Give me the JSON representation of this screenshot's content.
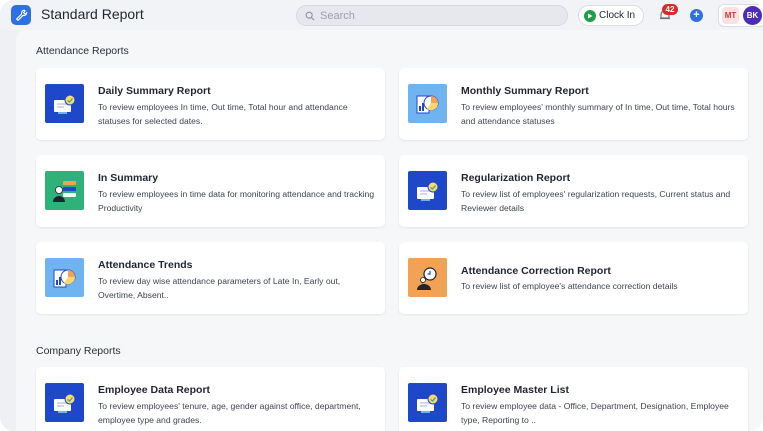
{
  "header": {
    "app_icon": "wrench-icon",
    "title": "Standard Report",
    "search_placeholder": "Search",
    "clock_in_label": "Clock In",
    "notification_count": "42",
    "user_initials": "MT",
    "avatar_initials": "BK"
  },
  "sections": [
    {
      "title": "Attendance Reports",
      "cards": [
        {
          "title": "Daily Summary Report",
          "desc": "To review employees In time, Out time, Total hour and attendance statuses for selected dates.",
          "icon": "report-chart-icon"
        },
        {
          "title": "Monthly Summary Report",
          "desc": "To review employees' monthly summary of In time, Out time, Total hours and attendance statuses",
          "icon": "pie-chart-icon"
        },
        {
          "title": "In Summary",
          "desc": "To review employees in time data for monitoring attendance and tracking Productivity",
          "icon": "person-list-icon"
        },
        {
          "title": "Regularization Report",
          "desc": "To review list of employees' regularization requests, Current status and Reviewer details",
          "icon": "report-chart-icon"
        },
        {
          "title": "Attendance Trends",
          "desc": "To review day wise attendance parameters of Late In, Early out, Overtime, Absent..",
          "icon": "pie-chart-icon"
        },
        {
          "title": "Attendance Correction Report",
          "desc": "To review list of employee's attendance correction details",
          "icon": "person-search-icon"
        }
      ]
    },
    {
      "title": "Company Reports",
      "cards": [
        {
          "title": "Employee Data Report",
          "desc": "To review employees' tenure, age, gender against office, department, employee type and grades.",
          "icon": "report-chart-icon"
        },
        {
          "title": "Employee Master List",
          "desc": "To review employee data - Office, Department, Designation, Employee type, Reporting to ..",
          "icon": "report-chart-icon"
        }
      ]
    }
  ],
  "colors": {
    "icon_blue": "#1f47c9",
    "icon_lightblue": "#6fb3f0",
    "icon_green": "#2fb27a",
    "icon_orange": "#f2a255",
    "accent": "#2f6fe4"
  }
}
